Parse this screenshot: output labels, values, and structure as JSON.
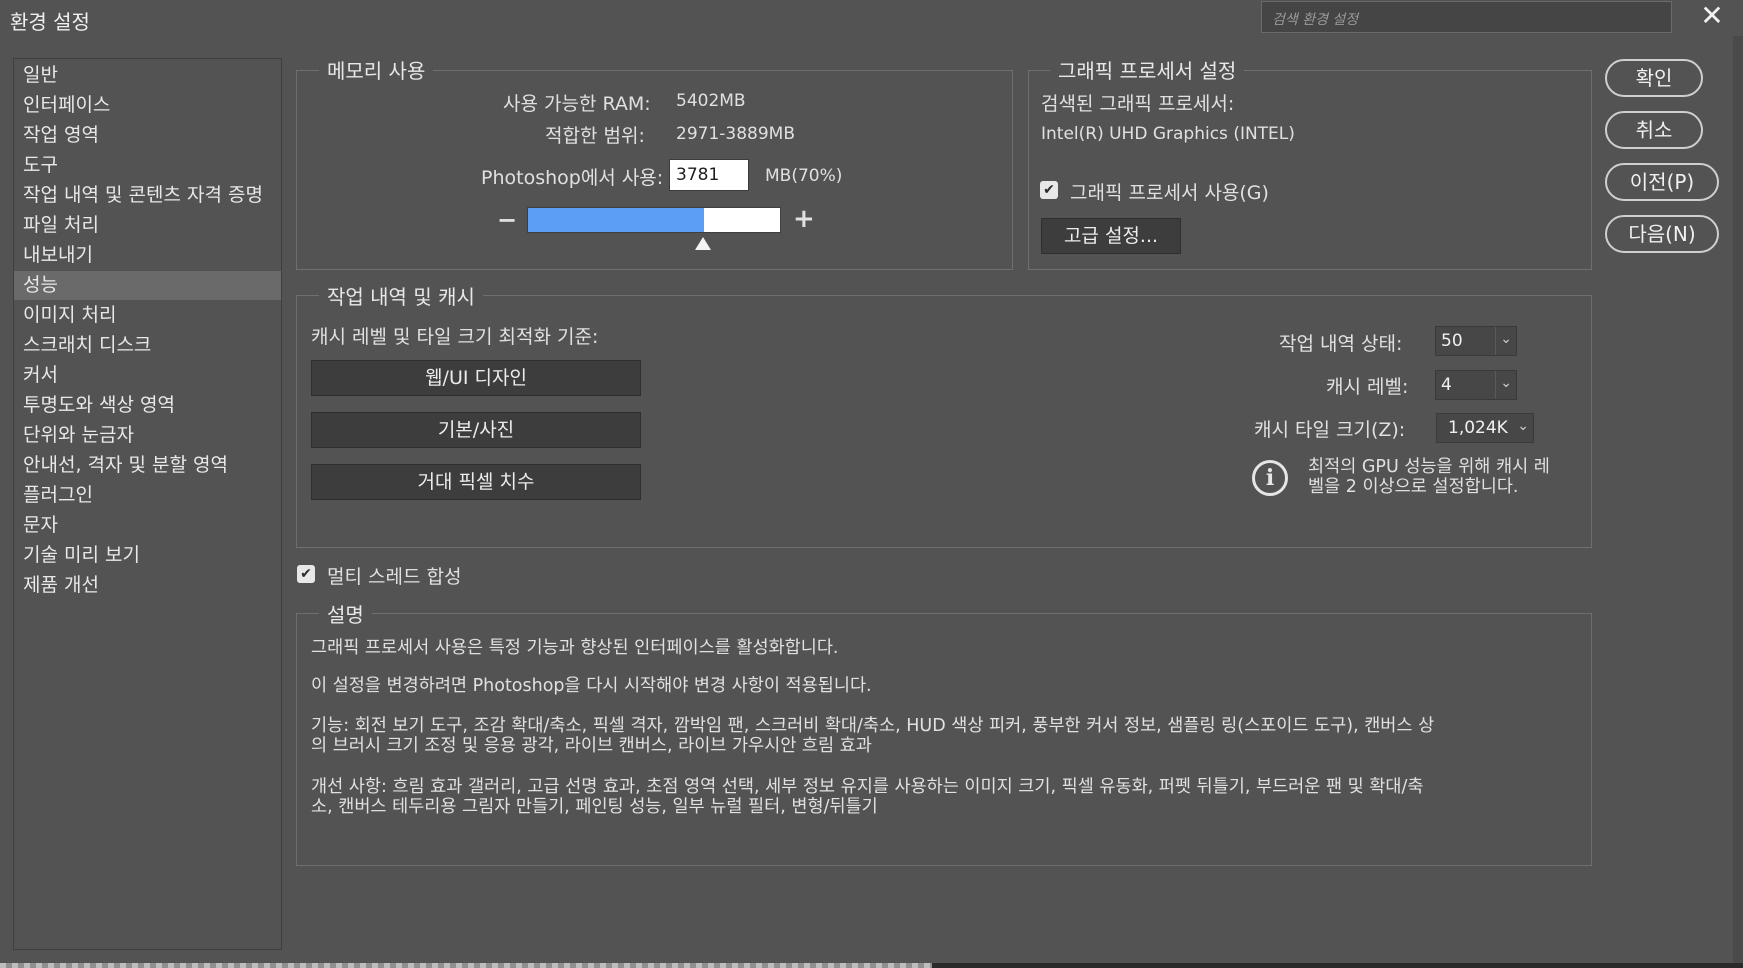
{
  "window": {
    "title": "환경 설정",
    "search_placeholder": "검색 환경 설정",
    "close_glyph": "✕"
  },
  "sidebar": {
    "items": [
      {
        "label": "일반"
      },
      {
        "label": "인터페이스"
      },
      {
        "label": "작업 영역"
      },
      {
        "label": "도구"
      },
      {
        "label": "작업 내역 및 콘텐츠 자격 증명"
      },
      {
        "label": "파일 처리"
      },
      {
        "label": "내보내기"
      },
      {
        "label": "성능",
        "selected": true
      },
      {
        "label": "이미지 처리"
      },
      {
        "label": "스크래치 디스크"
      },
      {
        "label": "커서"
      },
      {
        "label": "투명도와 색상 영역"
      },
      {
        "label": "단위와 눈금자"
      },
      {
        "label": "안내선, 격자 및 분할 영역"
      },
      {
        "label": "플러그인"
      },
      {
        "label": "문자"
      },
      {
        "label": "기술 미리 보기"
      },
      {
        "label": "제품 개선"
      }
    ]
  },
  "memory": {
    "legend": "메모리 사용",
    "available_ram_label": "사용 가능한 RAM:",
    "available_ram_value": "5402MB",
    "ideal_range_label": "적합한 범위:",
    "ideal_range_value": "2971-3889MB",
    "photoshop_use_label": "Photoshop에서 사용:",
    "photoshop_use_value": "3781",
    "photoshop_use_unit": "MB(70%)",
    "minus_glyph": "−",
    "plus_glyph": "+",
    "slider_fraction": 0.7,
    "slider_fill_color": "#5a9ef5"
  },
  "gpu": {
    "legend": "그래픽 프로세서 설정",
    "detected_label": "검색된 그래픽 프로세서:",
    "detected_value": "Intel(R) UHD Graphics (INTEL)",
    "use_gpu_label": "그래픽 프로세서 사용(G)",
    "use_gpu_checked": true,
    "advanced_button": "고급 설정..."
  },
  "actions": {
    "ok": "확인",
    "cancel": "취소",
    "prev": "이전(P)",
    "next": "다음(N)"
  },
  "history_cache": {
    "legend": "작업 내역 및 캐시",
    "optimize_label": "캐시 레벨 및 타일 크기 최적화 기준:",
    "preset_buttons": [
      "웹/UI 디자인",
      "기본/사진",
      "거대 픽셀 치수"
    ],
    "history_states_label": "작업 내역 상태:",
    "history_states_value": "50",
    "cache_levels_label": "캐시 레벨:",
    "cache_levels_value": "4",
    "cache_tile_label": "캐시 타일 크기(Z):",
    "cache_tile_value": "1,024K",
    "info_line1": "최적의 GPU 성능을 위해 캐시 레",
    "info_line2": "벨을 2 이상으로 설정합니다.",
    "info_icon_glyph": "i"
  },
  "multithread": {
    "label": "멀티 스레드 합성",
    "checked": true,
    "check_glyph": "✔"
  },
  "description": {
    "legend": "설명",
    "line1": "그래픽 프로세서 사용은 특정 기능과 향상된 인터페이스를 활성화합니다.",
    "line2": "이 설정을 변경하려면 Photoshop을 다시 시작해야 변경 사항이 적용됩니다.",
    "line3a": "기능: 회전 보기 도구, 조감 확대/축소, 픽셀 격자, 깜박임 팬, 스크러비 확대/축소, HUD 색상 피커, 풍부한 커서 정보, 샘플링 링(스포이드 도구), 캔버스 상",
    "line3b": "의 브러시 크기 조정 및 응용 광각, 라이브 캔버스, 라이브 가우시안 흐림 효과",
    "line4a": "개선 사항: 흐림 효과 갤러리, 고급 선명 효과, 초점 영역 선택, 세부 정보 유지를 사용하는 이미지 크기, 픽셀 유동화, 퍼펫 뒤틀기, 부드러운 팬 및 확대/축",
    "line4b": "소, 캔버스 테두리용 그림자 만들기, 페인팅 성능, 일부 뉴럴 필터, 변형/뒤틀기"
  }
}
